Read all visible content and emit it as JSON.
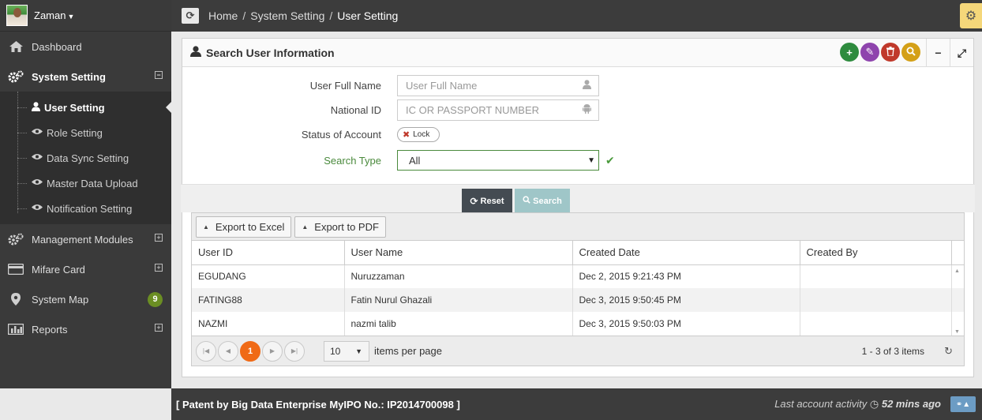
{
  "user": {
    "name": "Zaman"
  },
  "sidebar": {
    "items": [
      {
        "label": "Dashboard",
        "icon": "home-icon"
      },
      {
        "label": "System Setting",
        "icon": "cogs-icon",
        "expanded": true,
        "children": [
          {
            "label": "User Setting",
            "icon": "user-icon",
            "active": true
          },
          {
            "label": "Role Setting",
            "icon": "eye-icon"
          },
          {
            "label": "Data Sync Setting",
            "icon": "eye-icon"
          },
          {
            "label": "Master Data Upload",
            "icon": "eye-icon"
          },
          {
            "label": "Notification Setting",
            "icon": "eye-icon"
          }
        ]
      },
      {
        "label": "Management Modules",
        "icon": "cogs-icon"
      },
      {
        "label": "Mifare Card",
        "icon": "card-icon"
      },
      {
        "label": "System Map",
        "icon": "map-marker-icon",
        "badge": "9"
      },
      {
        "label": "Reports",
        "icon": "bar-chart-icon"
      }
    ]
  },
  "breadcrumb": {
    "home": "Home",
    "section": "System Setting",
    "current": "User Setting"
  },
  "widget": {
    "title": "Search User Information"
  },
  "form": {
    "full_name": {
      "label": "User Full Name",
      "placeholder": "User Full Name"
    },
    "national_id": {
      "label": "National ID",
      "placeholder": "IC OR PASSPORT NUMBER"
    },
    "status": {
      "label": "Status of Account",
      "toggle_text": "Lock"
    },
    "search_type": {
      "label": "Search Type",
      "value": "All"
    }
  },
  "actions": {
    "reset": "Reset",
    "search": "Search"
  },
  "grid": {
    "export_excel": "Export to Excel",
    "export_pdf": "Export to PDF",
    "columns": [
      "User ID",
      "User Name",
      "Created Date",
      "Created By"
    ],
    "rows": [
      {
        "user_id": "EGUDANG",
        "user_name": "Nuruzzaman",
        "created_date": "Dec 2, 2015 9:21:43 PM",
        "created_by": ""
      },
      {
        "user_id": "FATING88",
        "user_name": "Fatin Nurul Ghazali",
        "created_date": "Dec 3, 2015 9:50:45 PM",
        "created_by": ""
      },
      {
        "user_id": "NAZMI",
        "user_name": "nazmi talib",
        "created_date": "Dec 3, 2015 9:50:03 PM",
        "created_by": ""
      }
    ],
    "pager": {
      "current_page": "1",
      "page_size": "10",
      "items_per_page": "items per page",
      "info": "1 - 3 of 3 items"
    }
  },
  "footer": {
    "patent": "[ Patent by Big Data Enterprise   MyIPO No.: IP2014700098 ]",
    "activity_label": "Last account activity",
    "activity_value": "52 mins ago"
  },
  "colors": {
    "sidebar_bg": "#3a3a3a",
    "topbar_bg": "#3c3c3c",
    "pager_active": "#f06a16",
    "search_type_border": "#4a8a3c"
  }
}
